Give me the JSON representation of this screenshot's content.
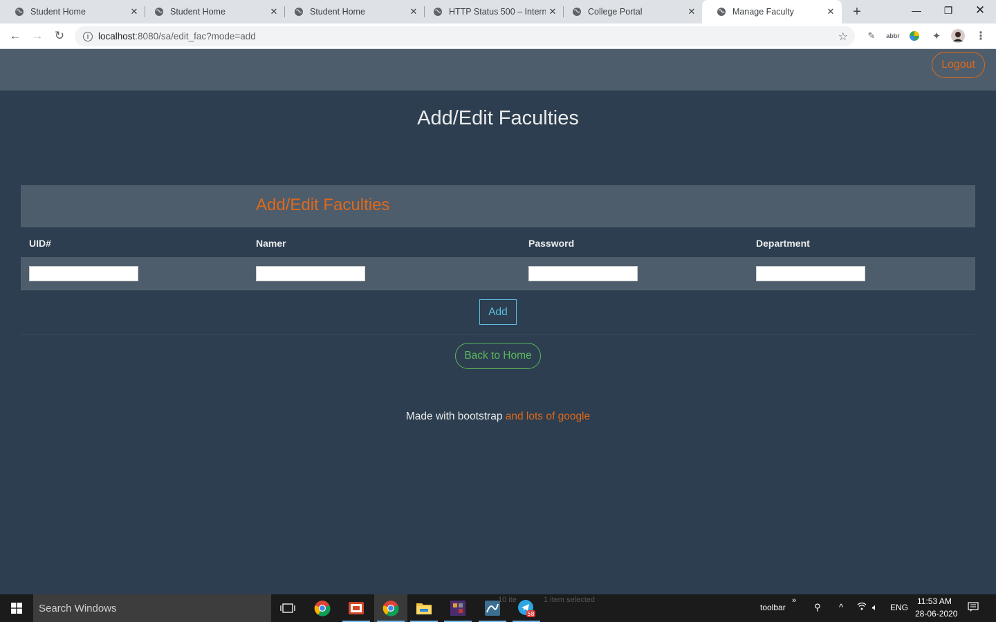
{
  "browser": {
    "tabs": [
      {
        "title": "Student Home",
        "active": false
      },
      {
        "title": "Student Home",
        "active": false
      },
      {
        "title": "Student Home",
        "active": false
      },
      {
        "title": "HTTP Status 500 – Interna",
        "active": false
      },
      {
        "title": "College Portal",
        "active": false
      },
      {
        "title": "Manage Faculty",
        "active": true
      }
    ],
    "url_host": "localhost",
    "url_rest": ":8080/sa/edit_fac?mode=add"
  },
  "page": {
    "logout_label": "Logout",
    "heading": "Add/Edit Faculties",
    "panel_title": "Add/Edit Faculties",
    "columns": [
      "UID#",
      "Namer",
      "Password",
      "Department"
    ],
    "fields": [
      {
        "value": ""
      },
      {
        "value": ""
      },
      {
        "value": ""
      },
      {
        "value": ""
      }
    ],
    "add_label": "Add",
    "back_home_label": "Back to Home",
    "footer_text": "Made with bootstrap",
    "footer_accent": "and lots of google"
  },
  "colors": {
    "background": "#2c3e50",
    "panel": "#4e5d6c",
    "accent_orange": "#df691a",
    "info_blue": "#5bc0de",
    "success_green": "#5cb85c"
  },
  "taskbar": {
    "search_placeholder": "Search Windows",
    "toolbar_label": "toolbar",
    "language": "ENG",
    "time": "11:53 AM",
    "date": "28-06-2020",
    "telegram_badge": "58",
    "ghost_items": "10 ite",
    "ghost_selected": "1 item selected"
  }
}
